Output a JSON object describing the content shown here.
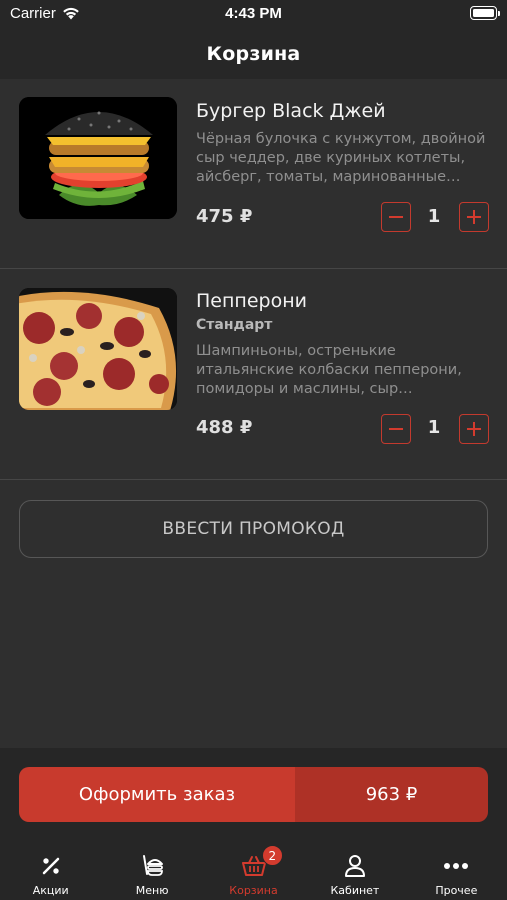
{
  "status_bar": {
    "carrier": "Carrier",
    "time": "4:43 PM"
  },
  "header": {
    "title": "Корзина"
  },
  "cart_items": [
    {
      "name": "Бургер Black Джей",
      "description": "Чёрная булочка с кунжутом, двойной сыр чеддер, две куриных котлеты, айсберг, томаты, маринованные огурцы",
      "price": "475 ₽",
      "quantity": "1",
      "image_icon": "burger-photo"
    },
    {
      "name": "Пепперони",
      "variant": "Стандарт",
      "description": "Шампиньоны, остренькие итальянские колбаски пепперони, помидоры и маслины, сыр Моцарелла, острый перец",
      "price": "488 ₽",
      "quantity": "1",
      "image_icon": "pizza-photo"
    }
  ],
  "promo": {
    "label": "ВВЕСТИ ПРОМОКОД"
  },
  "checkout": {
    "label": "Оформить заказ",
    "total": "963 ₽"
  },
  "tabs": [
    {
      "label": "Акции",
      "icon": "percent-icon"
    },
    {
      "label": "Меню",
      "icon": "menu-icon"
    },
    {
      "label": "Корзина",
      "icon": "basket-icon",
      "badge": "2",
      "active": true
    },
    {
      "label": "Кабинет",
      "icon": "profile-icon"
    },
    {
      "label": "Прочее",
      "icon": "more-icon"
    }
  ],
  "colors": {
    "accent": "#c83a2d",
    "accent_dark": "#ae3126",
    "background": "#2f2f2f",
    "bar": "#262626"
  }
}
